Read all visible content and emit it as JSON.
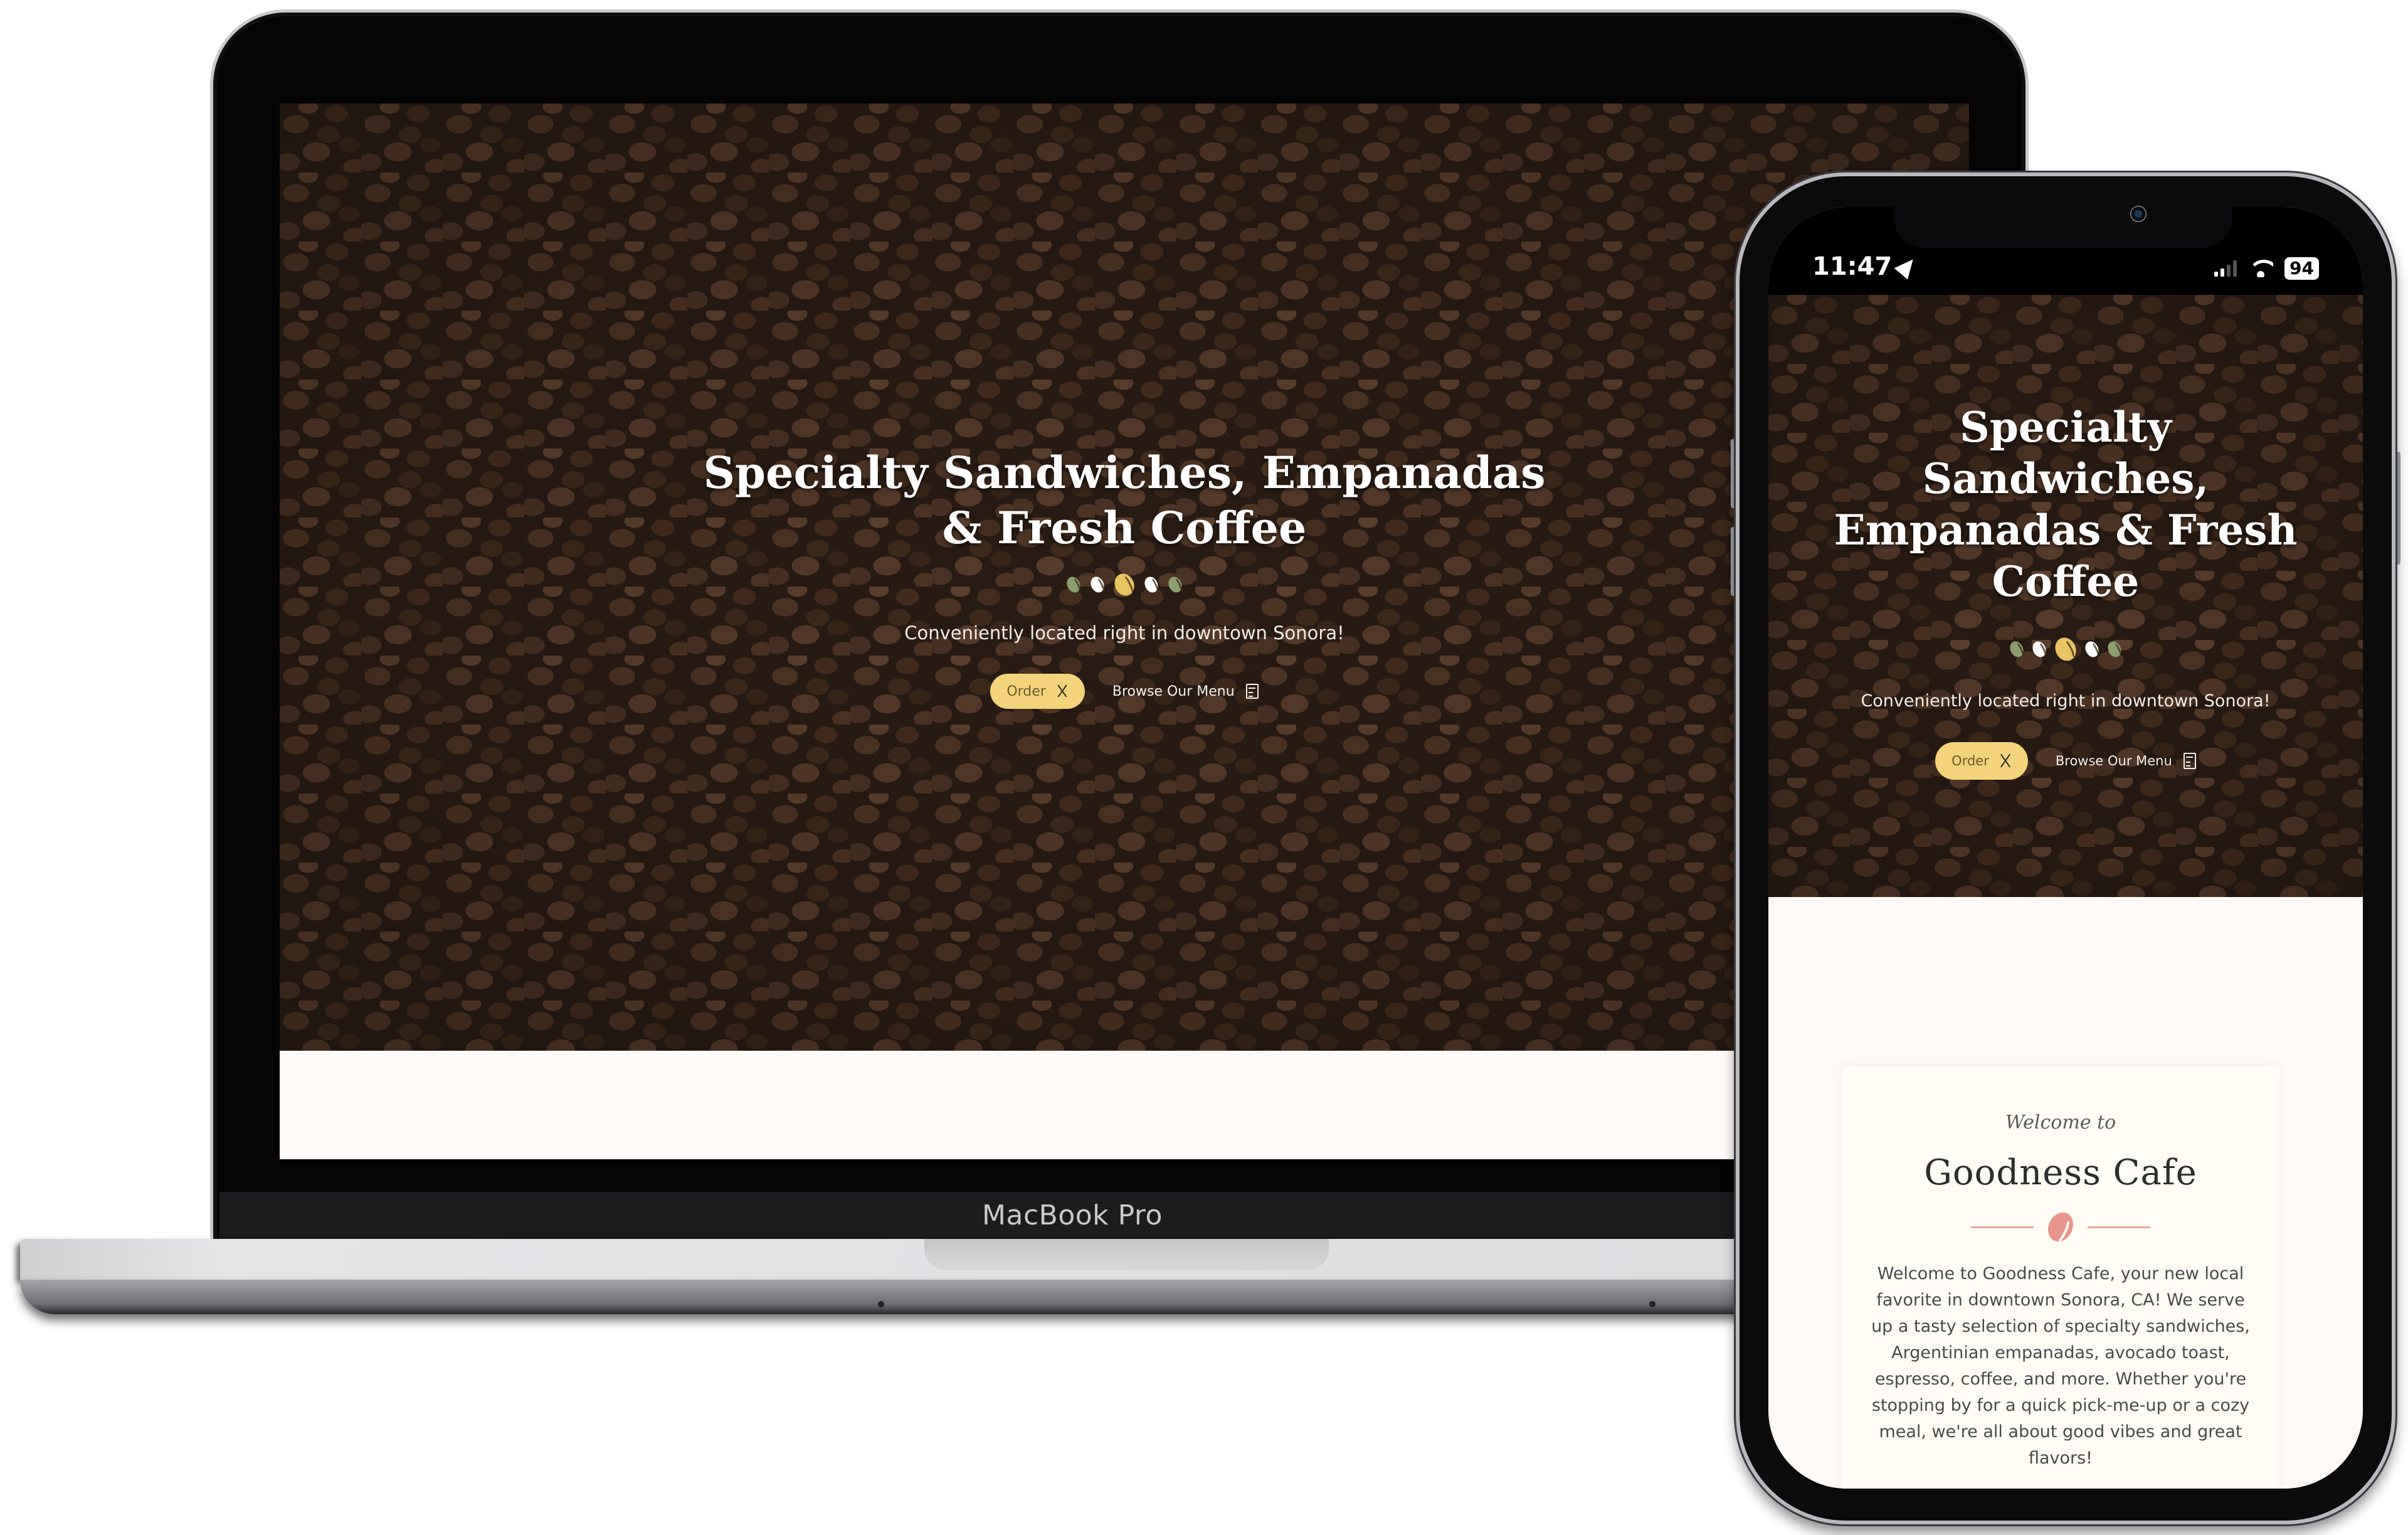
{
  "laptop": {
    "model_label": "MacBook Pro"
  },
  "site": {
    "hero": {
      "title": "Specialty Sandwiches, Empanadas & Fresh Coffee",
      "divider_beans": [
        {
          "color": "#8c9e6e"
        },
        {
          "color": "#ffffff"
        },
        {
          "color": "#eac463"
        },
        {
          "color": "#ffffff"
        },
        {
          "color": "#8c9e6e"
        }
      ],
      "subtitle": "Conveniently located right in downtown Sonora!",
      "order_button": {
        "label": "Order",
        "icon": "utensils-icon"
      },
      "menu_button": {
        "label": "Browse Our Menu",
        "icon": "menu-card-icon"
      }
    },
    "welcome": {
      "script": "Welcome to",
      "title": "Goodness Cafe",
      "divider_icon": "coffee-bean-icon",
      "body": "Welcome to Goodness Cafe, your new local favorite in downtown Sonora, CA! We serve up a tasty selection of specialty sandwiches, Argentinian empanadas, avocado toast, espresso, coffee, and more. Whether you're stopping by for a quick pick-me-up or a cozy meal, we're all about good vibes and great flavors!"
    }
  },
  "phone": {
    "status_bar": {
      "time": "11:47",
      "location_icon": "location-arrow-icon",
      "signal_bars": 2,
      "wifi_icon": "wifi-icon",
      "battery": "94"
    }
  },
  "colors": {
    "order_button_bg": "#f3d37b",
    "welcome_accent": "#e8968a",
    "page_bg": "#fdfaf7"
  }
}
